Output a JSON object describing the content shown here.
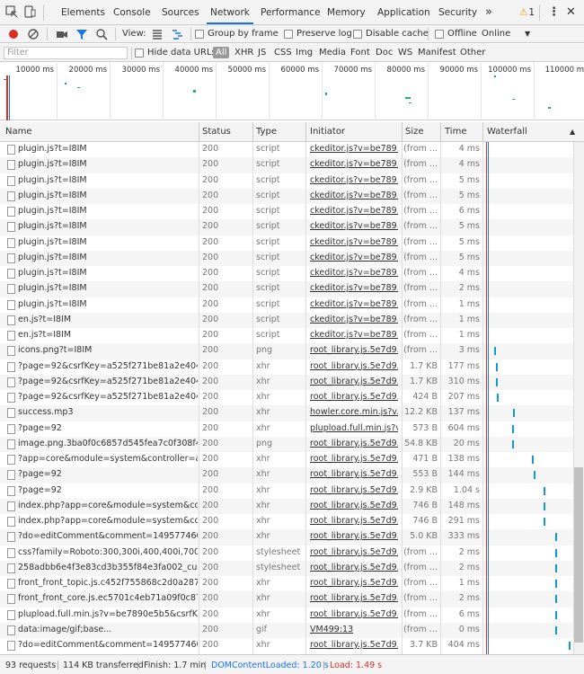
{
  "tabs": {
    "elements": "Elements",
    "console": "Console",
    "sources": "Sources",
    "network": "Network",
    "performance": "Performance",
    "memory": "Memory",
    "application": "Application",
    "security": "Security",
    "more": "»",
    "warnings": "1"
  },
  "toolbar": {
    "view_label": "View:",
    "group_by_frame": "Group by frame",
    "preserve_log": "Preserve log",
    "disable_cache": "Disable cache",
    "offline": "Offline",
    "throttle": "Online"
  },
  "filterbar": {
    "placeholder": "Filter",
    "hide_data_urls": "Hide data URLs",
    "types": [
      "All",
      "XHR",
      "JS",
      "CSS",
      "Img",
      "Media",
      "Font",
      "Doc",
      "WS",
      "Manifest",
      "Other"
    ]
  },
  "overview": {
    "ticks": [
      "10000 ms",
      "20000 ms",
      "30000 ms",
      "40000 ms",
      "50000 ms",
      "60000 ms",
      "70000 ms",
      "80000 ms",
      "90000 ms",
      "100000 ms",
      "110000 m"
    ]
  },
  "columns": {
    "name": "Name",
    "status": "Status",
    "type": "Type",
    "initiator": "Initiator",
    "size": "Size",
    "time": "Time",
    "waterfall": "Waterfall"
  },
  "requests": [
    {
      "name": "plugin.js?t=I8IM",
      "status": "200",
      "type": "script",
      "initiator": "ckeditor.js?v=be789...",
      "size": "(from ...",
      "time": "4 ms",
      "wf": null
    },
    {
      "name": "plugin.js?t=I8IM",
      "status": "200",
      "type": "script",
      "initiator": "ckeditor.js?v=be789...",
      "size": "(from ...",
      "time": "4 ms",
      "wf": null
    },
    {
      "name": "plugin.js?t=I8IM",
      "status": "200",
      "type": "script",
      "initiator": "ckeditor.js?v=be789...",
      "size": "(from ...",
      "time": "5 ms",
      "wf": null
    },
    {
      "name": "plugin.js?t=I8IM",
      "status": "200",
      "type": "script",
      "initiator": "ckeditor.js?v=be789...",
      "size": "(from ...",
      "time": "5 ms",
      "wf": null
    },
    {
      "name": "plugin.js?t=I8IM",
      "status": "200",
      "type": "script",
      "initiator": "ckeditor.js?v=be789...",
      "size": "(from ...",
      "time": "6 ms",
      "wf": null
    },
    {
      "name": "plugin.js?t=I8IM",
      "status": "200",
      "type": "script",
      "initiator": "ckeditor.js?v=be789...",
      "size": "(from ...",
      "time": "5 ms",
      "wf": null
    },
    {
      "name": "plugin.js?t=I8IM",
      "status": "200",
      "type": "script",
      "initiator": "ckeditor.js?v=be789...",
      "size": "(from ...",
      "time": "5 ms",
      "wf": null
    },
    {
      "name": "plugin.js?t=I8IM",
      "status": "200",
      "type": "script",
      "initiator": "ckeditor.js?v=be789...",
      "size": "(from ...",
      "time": "5 ms",
      "wf": null
    },
    {
      "name": "plugin.js?t=I8IM",
      "status": "200",
      "type": "script",
      "initiator": "ckeditor.js?v=be789...",
      "size": "(from ...",
      "time": "4 ms",
      "wf": null
    },
    {
      "name": "plugin.js?t=I8IM",
      "status": "200",
      "type": "script",
      "initiator": "ckeditor.js?v=be789...",
      "size": "(from ...",
      "time": "2 ms",
      "wf": null
    },
    {
      "name": "plugin.js?t=I8IM",
      "status": "200",
      "type": "script",
      "initiator": "ckeditor.js?v=be789...",
      "size": "(from ...",
      "time": "1 ms",
      "wf": null
    },
    {
      "name": "en.js?t=I8IM",
      "status": "200",
      "type": "script",
      "initiator": "ckeditor.js?v=be789...",
      "size": "(from ...",
      "time": "1 ms",
      "wf": null
    },
    {
      "name": "en.js?t=I8IM",
      "status": "200",
      "type": "script",
      "initiator": "ckeditor.js?v=be789...",
      "size": "(from ...",
      "time": "1 ms",
      "wf": null
    },
    {
      "name": "icons.png?t=I8IM",
      "status": "200",
      "type": "png",
      "initiator": "root_library.js.5e7d9...",
      "size": "(from ...",
      "time": "3 ms",
      "wf": 0.1
    },
    {
      "name": "?page=92&csrfKey=a525f271be81a2e404b...",
      "status": "200",
      "type": "xhr",
      "initiator": "root_library.js.5e7d9...",
      "size": "1.7 KB",
      "time": "177 ms",
      "wf": 0.12
    },
    {
      "name": "?page=92&csrfKey=a525f271be81a2e404b...",
      "status": "200",
      "type": "xhr",
      "initiator": "root_library.js.5e7d9...",
      "size": "1.7 KB",
      "time": "310 ms",
      "wf": 0.13
    },
    {
      "name": "?page=92&csrfKey=a525f271be81a2e404b...",
      "status": "200",
      "type": "xhr",
      "initiator": "root_library.js.5e7d9...",
      "size": "424 B",
      "time": "207 ms",
      "wf": 0.14
    },
    {
      "name": "success.mp3",
      "status": "200",
      "type": "xhr",
      "initiator": "howler.core.min.js?v...",
      "size": "12.2 KB",
      "time": "137 ms",
      "wf": 0.32
    },
    {
      "name": "?page=92",
      "status": "200",
      "type": "xhr",
      "initiator": "plupload.full.min.js?v...",
      "size": "573 B",
      "time": "604 ms",
      "wf": 0.31
    },
    {
      "name": "image.png.3ba0f0c6857d545fea7c0f308f4a...",
      "status": "200",
      "type": "png",
      "initiator": "root_library.js.5e7d9...",
      "size": "54.8 KB",
      "time": "20 ms",
      "wf": 0.31
    },
    {
      "name": "?app=core&module=system&controller=aj...",
      "status": "200",
      "type": "xhr",
      "initiator": "root_library.js.5e7d9...",
      "size": "471 B",
      "time": "138 ms",
      "wf": 0.54
    },
    {
      "name": "?page=92",
      "status": "200",
      "type": "xhr",
      "initiator": "root_library.js.5e7d9...",
      "size": "553 B",
      "time": "144 ms",
      "wf": 0.56
    },
    {
      "name": "?page=92",
      "status": "200",
      "type": "xhr",
      "initiator": "root_library.js.5e7d9...",
      "size": "2.9 KB",
      "time": "1.04 s",
      "wf": 0.68
    },
    {
      "name": "index.php?app=core&module=system&co...",
      "status": "200",
      "type": "xhr",
      "initiator": "root_library.js.5e7d9...",
      "size": "746 B",
      "time": "148 ms",
      "wf": 0.68
    },
    {
      "name": "index.php?app=core&module=system&co...",
      "status": "200",
      "type": "xhr",
      "initiator": "root_library.js.5e7d9...",
      "size": "746 B",
      "time": "291 ms",
      "wf": 0.68
    },
    {
      "name": "?do=editComment&comment=149577460...",
      "status": "200",
      "type": "xhr",
      "initiator": "root_library.js.5e7d9...",
      "size": "5.0 KB",
      "time": "333 ms",
      "wf": 0.81
    },
    {
      "name": "css?family=Roboto:300,300i,400,400i,700,7...",
      "status": "200",
      "type": "stylesheet",
      "initiator": "root_library.js.5e7d9...",
      "size": "(from ...",
      "time": "2 ms",
      "wf": 0.81
    },
    {
      "name": "258adbb6e4f3e83cd3b355f84e3fa002_cust...",
      "status": "200",
      "type": "stylesheet",
      "initiator": "root_library.js.5e7d9...",
      "size": "(from ...",
      "time": "2 ms",
      "wf": 0.81
    },
    {
      "name": "front_front_topic.js.c452f755868c2d0a2872...",
      "status": "200",
      "type": "xhr",
      "initiator": "root_library.js.5e7d9...",
      "size": "(from ...",
      "time": "1 ms",
      "wf": 0.81
    },
    {
      "name": "front_front_core.js.ec5701c4eb71a09f0c873...",
      "status": "200",
      "type": "xhr",
      "initiator": "root_library.js.5e7d9...",
      "size": "(from ...",
      "time": "2 ms",
      "wf": 0.81
    },
    {
      "name": "plupload.full.min.js?v=be7890e5b5&csrfKey...",
      "status": "200",
      "type": "xhr",
      "initiator": "root_library.js.5e7d9...",
      "size": "(from ...",
      "time": "6 ms",
      "wf": 0.81
    },
    {
      "name": "data:image/gif;base...",
      "status": "200",
      "type": "gif",
      "initiator": "VM499:13",
      "size": "(from ...",
      "time": "0 ms",
      "wf": 0.81
    },
    {
      "name": "?do=editComment&comment=1495774603",
      "status": "200",
      "type": "xhr",
      "initiator": "root_library.js.5e7d9...",
      "size": "3.7 KB",
      "time": "404 ms",
      "wf": 0.97
    }
  ],
  "statusbar": {
    "requests": "93 requests",
    "transferred": "114 KB transferred",
    "finish": "Finish: 1.7 min",
    "dcl": "DOMContentLoaded: 1.20 s",
    "load": "Load: 1.49 s"
  },
  "colors": {
    "accent": "#1a73e8",
    "record": "#d93025",
    "waterfall_bar": "#0f9ad6",
    "dcl_line": "#1a73e8",
    "load_line": "#d93025"
  }
}
